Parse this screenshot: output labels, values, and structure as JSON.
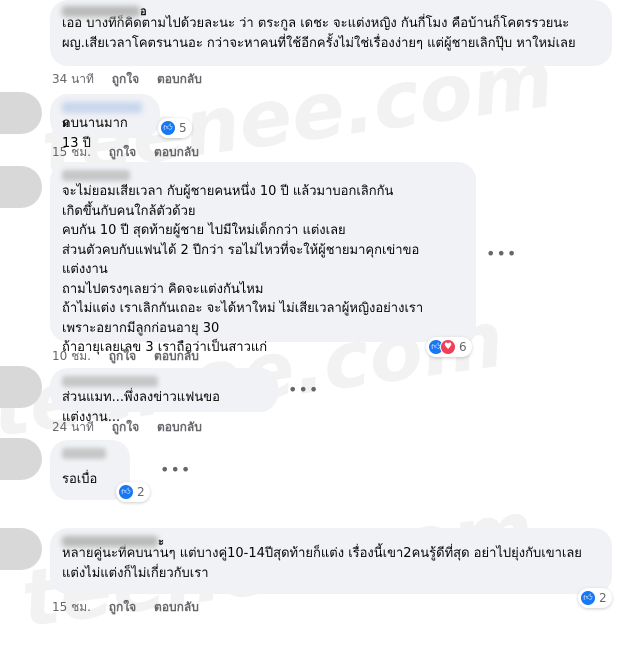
{
  "watermark": "teenee.com",
  "labels": {
    "like": "ถูกใจ",
    "reply": "ตอบกลับ"
  },
  "colors": {
    "like": "#1877f2",
    "love": "#f33e58",
    "bubble": "#f0f2f5",
    "meta": "#65676b"
  },
  "comments": [
    {
      "author_fragment": "อ",
      "text": "เออ บางทีก็คิดตามไปด้วยละนะ ว่า ตระกูล เดชะ จะแต่งหญิง กันกี่โมง คือบ้านก็โคตรรวยนะ\nผญ.เสียเวลาโคตรนานอะ กว่าจะหาคนที่ใช้อีกครั้งไม่ใช่เรื่องง่ายๆ แต่ผู้ชายเลิกปุ๊บ หาใหม่เลย",
      "time": "34 นาที",
      "reactions": null
    },
    {
      "author_fragment": "ม",
      "text": "คบนานมาก 13 ปี",
      "time": "15 ชม.",
      "reactions": {
        "count": "5",
        "types": [
          "like-icon"
        ]
      }
    },
    {
      "author_fragment": "",
      "text": "จะไม่ยอมเสียเวลา กับผู้ชายคนหนึ่ง 10 ปี แล้วมาบอกเลิกกัน\nเกิดขึ้นกับคนใกล้ตัวด้วย\nคบกัน 10 ปี สุดท้ายผู้ชาย ไปมีใหม่เด็กกว่า แต่งเลย\nส่วนตัวคบกับแฟนได้ 2 ปีกว่า รอไม่ไหวที่จะให้ผู้ชายมาคุกเข่าขอแต่งงาน\nถามไปตรงๆเลยว่า คิดจะแต่งกันไหม\nถ้าไม่แต่ง เราเลิกกันเถอะ จะได้หาใหม่ ไม่เสียเวลาผู้หญิงอย่างเรา\nเพราะอยากมีลูกก่อนอายุ 30\nถ้าอายุเลยเลข 3 เราถือว่าเป็นสาวแก่",
      "time": "10 ชม.",
      "reactions": {
        "count": "6",
        "types": [
          "like-icon",
          "love-icon"
        ]
      }
    },
    {
      "author_fragment": "",
      "text": "ส่วนแมท...พึ่งลงข่าวแฟนขอแต่งงาน...",
      "time": "24 นาที",
      "reactions": null
    },
    {
      "author_fragment": "",
      "text": "รอเบื่อ",
      "time": "",
      "reactions": {
        "count": "2",
        "types": [
          "like-icon"
        ]
      }
    },
    {
      "author_fragment": "ะ",
      "text": "หลายคู่นะที่คบนานๆ แต่บางคู่10-14ปีสุดท้ายก็แต่ง เรื่องนี้เขา2คนรู้ดีที่สุด อย่าไปยุ่งกับเขาเลย\nแต่งไม่แต่งก็ไม่เกี่ยวกับเรา",
      "time": "15 ชม.",
      "reactions": {
        "count": "2",
        "types": [
          "like-icon"
        ]
      }
    }
  ]
}
